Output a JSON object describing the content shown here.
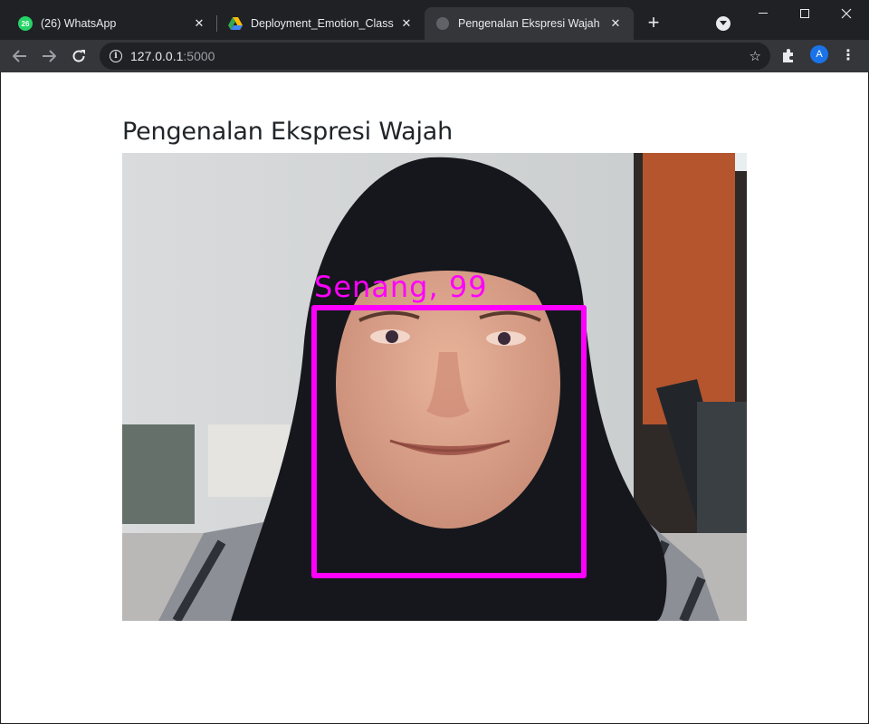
{
  "browser": {
    "tabs": [
      {
        "title": "(26) WhatsApp",
        "badge": "26",
        "icon": "whatsapp-icon",
        "active": false
      },
      {
        "title": "Deployment_Emotion_Classifica",
        "icon": "google-drive-icon",
        "active": false
      },
      {
        "title": "Pengenalan Ekspresi Wajah",
        "icon": "globe-icon",
        "active": true
      }
    ],
    "address": {
      "host": "127.0.0.1",
      "port": ":5000"
    },
    "profile_initial": "A"
  },
  "page": {
    "heading": "Pengenalan Ekspresi Wajah",
    "detection": {
      "label": "Senang,  99",
      "box_color": "#ff00ff"
    }
  }
}
